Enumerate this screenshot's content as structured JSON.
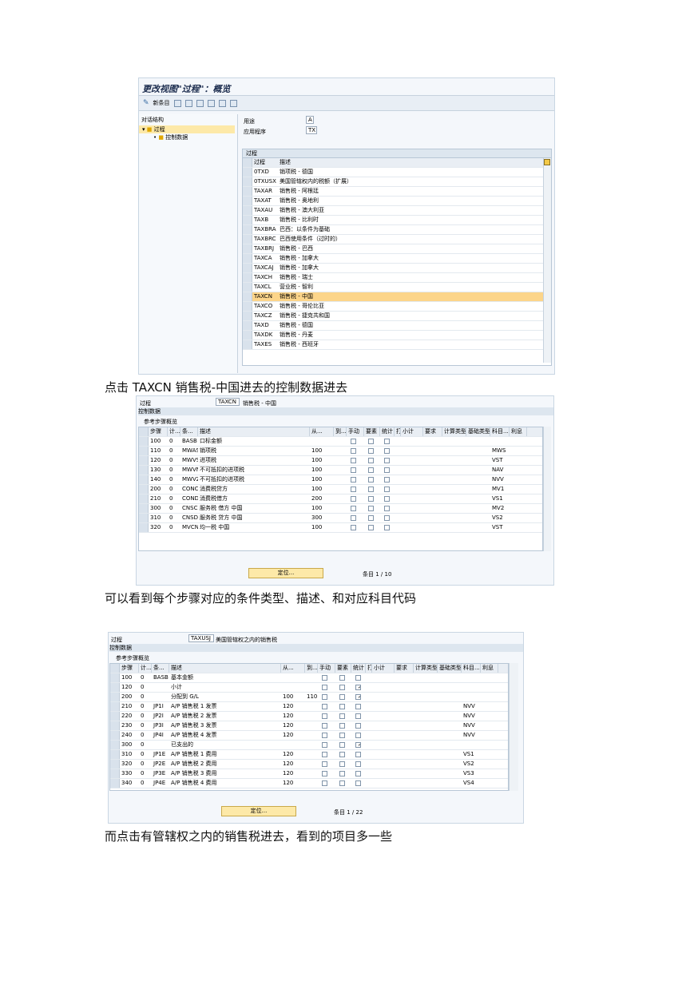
{
  "shot1": {
    "title": "更改视图\"过程\"：概览",
    "toolbar_new": "新条目",
    "tree_title": "对话结构",
    "tree_items": [
      "过程",
      "控制数据"
    ],
    "usage_label": "用途",
    "usage_value": "A",
    "app_label": "应用程序",
    "app_value": "TX",
    "grid_title": "过程",
    "col_proc": "过程",
    "col_desc": "描述",
    "rows": [
      {
        "code": "0TXD",
        "desc": "销项税 - 德国"
      },
      {
        "code": "0TXUSX",
        "desc": "美国管辖权内的税额（扩展）"
      },
      {
        "code": "TAXAR",
        "desc": "销售税 - 阿根廷"
      },
      {
        "code": "TAXAT",
        "desc": "销售税 - 奥地利"
      },
      {
        "code": "TAXAU",
        "desc": "销售税 - 澳大利亚"
      },
      {
        "code": "TAXB",
        "desc": "销售税 - 比利时"
      },
      {
        "code": "TAXBRA",
        "desc": "巴西：以条件为基础"
      },
      {
        "code": "TAXBRC",
        "desc": "巴西使用条件（过时的）"
      },
      {
        "code": "TAXBRJ",
        "desc": "销售税 - 巴西"
      },
      {
        "code": "TAXCA",
        "desc": "销售税 - 加拿大"
      },
      {
        "code": "TAXCAJ",
        "desc": "销售税 - 加拿大"
      },
      {
        "code": "TAXCH",
        "desc": "销售税 - 瑞士"
      },
      {
        "code": "TAXCL",
        "desc": "营业税 - 智利"
      },
      {
        "code": "TAXCN",
        "desc": "销售税 - 中国",
        "selected": true
      },
      {
        "code": "TAXCO",
        "desc": "销售税 - 哥伦比亚"
      },
      {
        "code": "TAXCZ",
        "desc": "销售税 - 捷克共和国"
      },
      {
        "code": "TAXD",
        "desc": "销售税 - 德国"
      },
      {
        "code": "TAXDK",
        "desc": "销售税 - 丹麦"
      },
      {
        "code": "TAXES",
        "desc": "销售税 - 西班牙"
      }
    ]
  },
  "caption1": "点击 TAXCN 销售税-中国进去的控制数据进去",
  "shot2": {
    "proc_label": "过程",
    "proc_value": "TAXCN",
    "proc_desc": "销售税 - 中国",
    "section": "控制数据",
    "sub": "参考步骤概览",
    "headers": [
      "步骤",
      "计...",
      "条...",
      "描述",
      "从...",
      "到...",
      "手动",
      "要素",
      "统计",
      "打",
      "小计",
      "要求",
      "计算类型",
      "基础类型",
      "科目...",
      "利息"
    ],
    "rows": [
      {
        "step": "100",
        "cnt": "0",
        "cond": "BASB",
        "desc": "口标金额",
        "from": "",
        "acct": "",
        "stat": false
      },
      {
        "step": "110",
        "cnt": "0",
        "cond": "MWAS",
        "desc": "销项税",
        "from": "100",
        "acct": "MWS",
        "stat": false
      },
      {
        "step": "120",
        "cnt": "0",
        "cond": "MWVS",
        "desc": "进项税",
        "from": "100",
        "acct": "VST",
        "stat": false
      },
      {
        "step": "130",
        "cnt": "0",
        "cond": "MWVN",
        "desc": "不可抵扣的进项税",
        "from": "100",
        "acct": "NAV",
        "stat": false
      },
      {
        "step": "140",
        "cnt": "0",
        "cond": "MWVZ",
        "desc": "不可抵扣的进项税",
        "from": "100",
        "acct": "NVV",
        "stat": false
      },
      {
        "step": "200",
        "cnt": "0",
        "cond": "CONC",
        "desc": "消费税贷方",
        "from": "100",
        "acct": "MV1",
        "stat": false
      },
      {
        "step": "210",
        "cnt": "0",
        "cond": "COND",
        "desc": "消费税借方",
        "from": "200",
        "acct": "VS1",
        "stat": false
      },
      {
        "step": "300",
        "cnt": "0",
        "cond": "CNSC",
        "desc": "服务税 借方 中国",
        "from": "100",
        "acct": "MV2",
        "stat": false
      },
      {
        "step": "310",
        "cnt": "0",
        "cond": "CNSD",
        "desc": "服务税 贷方 中国",
        "from": "300",
        "acct": "VS2",
        "stat": false
      },
      {
        "step": "320",
        "cnt": "0",
        "cond": "MVCN",
        "desc": "均一税 中国",
        "from": "100",
        "acct": "VST",
        "stat": false
      }
    ],
    "btn": "定位...",
    "count": "条目 1 / 10"
  },
  "caption2": "可以看到每个步骤对应的条件类型、描述、和对应科目代码",
  "shot3": {
    "proc_label": "过程",
    "proc_value": "TAXUSJ",
    "proc_desc": "美国管辖权之内的销售税",
    "section": "控制数据",
    "sub": "参考步骤概览",
    "headers": [
      "步骤",
      "计...",
      "条...",
      "描述",
      "从...",
      "到...",
      "手动",
      "要素",
      "统计",
      "打",
      "小计",
      "要求",
      "计算类型",
      "基础类型",
      "科目...",
      "利息"
    ],
    "rows": [
      {
        "step": "100",
        "cnt": "0",
        "cond": "BASB",
        "desc": "基本金额",
        "from": "",
        "to": "",
        "acct": "",
        "stat": false
      },
      {
        "step": "120",
        "cnt": "0",
        "cond": "",
        "desc": "小计",
        "from": "",
        "to": "",
        "acct": "",
        "stat": true
      },
      {
        "step": "200",
        "cnt": "0",
        "cond": "",
        "desc": "分配到 G/L",
        "from": "100",
        "to": "110",
        "acct": "",
        "stat": true
      },
      {
        "step": "210",
        "cnt": "0",
        "cond": "JP1I",
        "desc": "A/P 销售税 1 发票",
        "from": "120",
        "to": "",
        "acct": "NVV",
        "stat": false
      },
      {
        "step": "220",
        "cnt": "0",
        "cond": "JP2I",
        "desc": "A/P 销售税 2 发票",
        "from": "120",
        "to": "",
        "acct": "NVV",
        "stat": false
      },
      {
        "step": "230",
        "cnt": "0",
        "cond": "JP3I",
        "desc": "A/P 销售税 3 发票",
        "from": "120",
        "to": "",
        "acct": "NVV",
        "stat": false
      },
      {
        "step": "240",
        "cnt": "0",
        "cond": "JP4I",
        "desc": "A/P 销售税 4 发票",
        "from": "120",
        "to": "",
        "acct": "NVV",
        "stat": false
      },
      {
        "step": "300",
        "cnt": "0",
        "cond": "",
        "desc": "已支出的",
        "from": "",
        "to": "",
        "acct": "",
        "stat": true
      },
      {
        "step": "310",
        "cnt": "0",
        "cond": "JP1E",
        "desc": "A/P 销售税 1 费用",
        "from": "120",
        "to": "",
        "acct": "VS1",
        "stat": false
      },
      {
        "step": "320",
        "cnt": "0",
        "cond": "JP2E",
        "desc": "A/P 销售税 2 费用",
        "from": "120",
        "to": "",
        "acct": "VS2",
        "stat": false
      },
      {
        "step": "330",
        "cnt": "0",
        "cond": "JP3E",
        "desc": "A/P 销售税 3 费用",
        "from": "120",
        "to": "",
        "acct": "VS3",
        "stat": false
      },
      {
        "step": "340",
        "cnt": "0",
        "cond": "JP4E",
        "desc": "A/P 销售税 4 费用",
        "from": "120",
        "to": "",
        "acct": "VS4",
        "stat": false
      }
    ],
    "btn": "定位...",
    "count": "条目 1 / 22"
  },
  "caption3": "而点击有管辖权之内的销售税进去，看到的项目多一些"
}
